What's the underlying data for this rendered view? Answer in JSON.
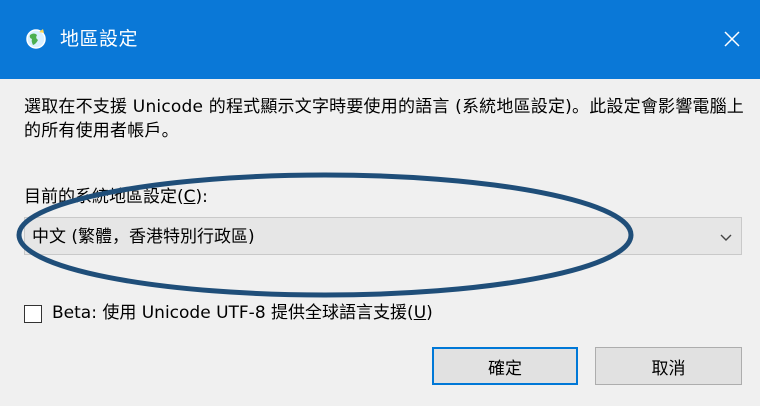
{
  "window": {
    "title": "地區設定",
    "title_icon": "globe-icon",
    "close_icon": "close-icon"
  },
  "dialog": {
    "description": "選取在不支援 Unicode 的程式顯示文字時要使用的語言 (系統地區設定)。此設定會影響電腦上的所有使用者帳戶。",
    "system_locale_label_prefix": "目前的系統地區設定(",
    "system_locale_label_mnemonic": "C",
    "system_locale_label_suffix": "):",
    "system_locale_value": "中文 (繁體，香港特別行政區)",
    "dropdown_icon": "chevron-down-icon",
    "beta_label_prefix": "Beta: 使用 Unicode UTF-8 提供全球語言支援(",
    "beta_label_mnemonic": "U",
    "beta_label_suffix": ")",
    "beta_checked": false,
    "ok_label": "確定",
    "cancel_label": "取消"
  },
  "colors": {
    "titlebar": "#0a78d7",
    "body": "#f0f0f0",
    "annotation_ellipse": "#1f4e79",
    "default_button_border": "#0078d7"
  }
}
